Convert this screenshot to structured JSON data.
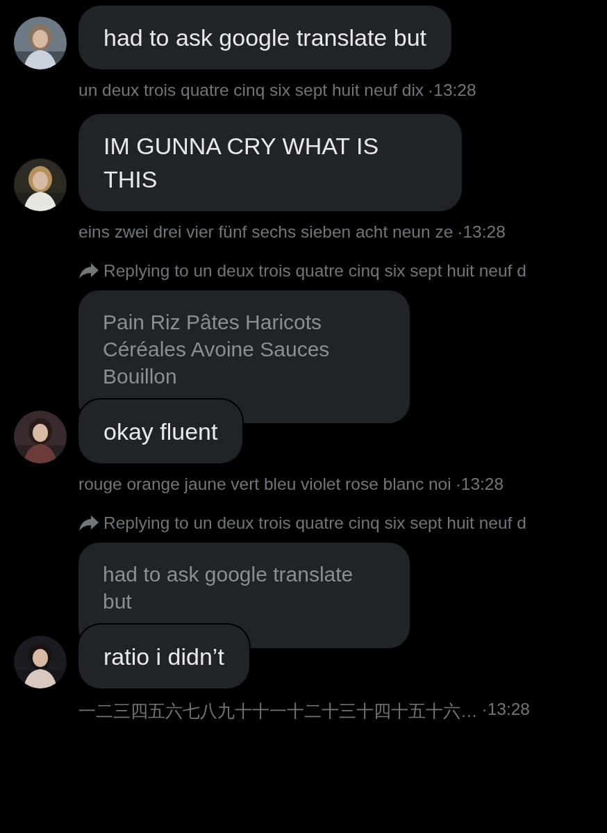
{
  "messages": [
    {
      "text": "had to ask google translate but",
      "sender": "un deux trois quatre cinq six sept huit neuf dix",
      "time": "·13:28"
    },
    {
      "text": "IM GUNNA CRY WHAT IS THIS",
      "sender": "eins zwei drei vier fünf sechs sieben acht neun ze",
      "time": "·13:28"
    },
    {
      "reply": {
        "label": "Replying to un deux trois quatre cinq six sept huit neuf d",
        "quoted": "Pain Riz Pâtes Haricots Céréales Avoine Sauces Bouillon"
      },
      "text": "okay fluent",
      "sender": "rouge orange jaune vert bleu violet rose blanc noi",
      "time": "·13:28"
    },
    {
      "reply": {
        "label": "Replying to un deux trois quatre cinq six sept huit neuf d",
        "quoted": "had to ask google translate but"
      },
      "text": "ratio i didn’t",
      "sender": "一二三四五六七八九十十一十二十三十四十五十六…",
      "time": "·13:28"
    }
  ]
}
